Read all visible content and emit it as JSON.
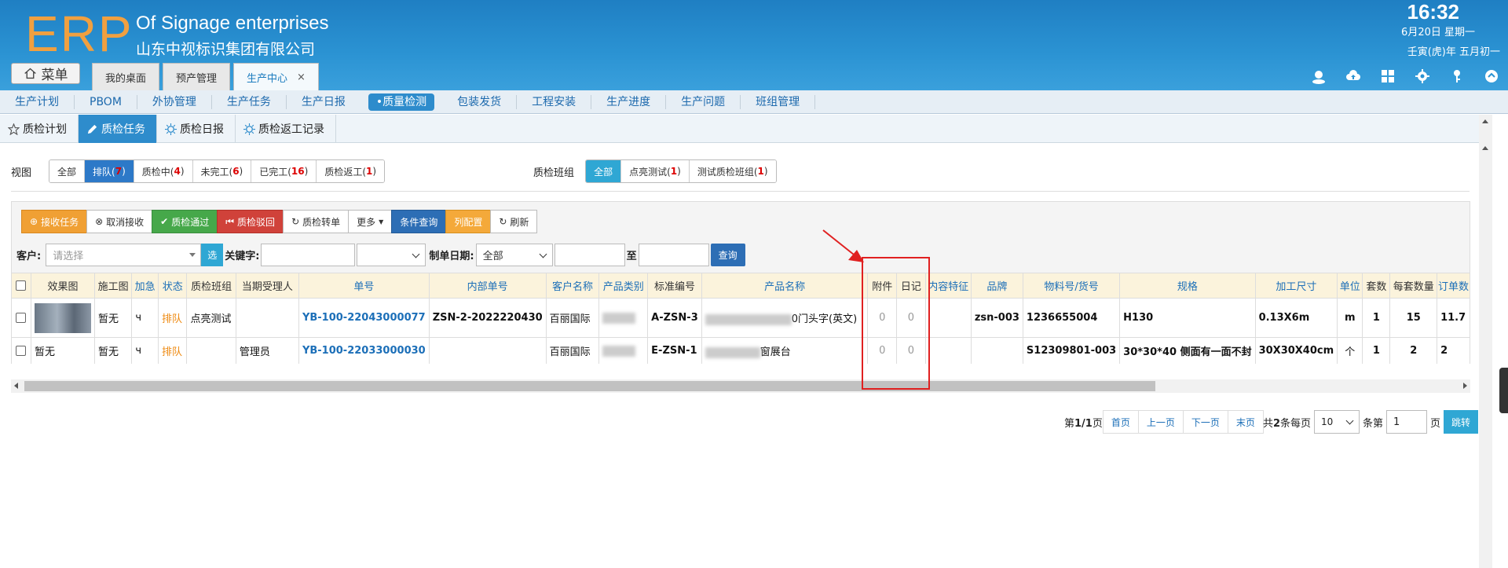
{
  "header": {
    "logo": "ERP",
    "subtitle_en": "Of Signage enterprises",
    "subtitle_cn": "山东中视标识集团有限公司",
    "time": "16:32",
    "date": "6月20日 星期一",
    "lunar": "壬寅(虎)年 五月初一",
    "menu_label": "菜单",
    "tabs": [
      {
        "label": "我的桌面"
      },
      {
        "label": "预产管理"
      },
      {
        "label": "生产中心",
        "close": "×"
      }
    ]
  },
  "nav": [
    "生产计划",
    "PBOM",
    "外协管理",
    "生产任务",
    "生产日报",
    "•质量检测",
    "包装发货",
    "工程安装",
    "生产进度",
    "生产问题",
    "班组管理"
  ],
  "subtabs": [
    "质检计划",
    "质检任务",
    "质检日报",
    "质检返工记录"
  ],
  "view": {
    "label": "视图",
    "all": "全部",
    "queue": "排队(",
    "queue_count": "7",
    "queue_close": ")",
    "inspecting": "质检中(",
    "inspecting_count": "4",
    "unfinished": "未完工(",
    "unfinished_count": "6",
    "finished": "已完工(",
    "finished_count": "16",
    "rework": "质检返工(",
    "rework_count": "1",
    "close": ")"
  },
  "group": {
    "label": "质检班组",
    "all": "全部",
    "g1": "点亮测试(",
    "g1_count": "1",
    "g2": "测试质检班组(",
    "g2_count": "1",
    "close": ")"
  },
  "toolbar": {
    "receive": "接收任务",
    "cancel_receive": "取消接收",
    "pass": "质检通过",
    "reject": "质检驳回",
    "transfer": "质检转单",
    "more": "更多",
    "condition_query": "条件查询",
    "columns": "列配置",
    "refresh": "刷新"
  },
  "filter": {
    "customer_label": "客户:",
    "customer_placeholder": "请选择",
    "select_btn": "选",
    "keyword_label": "关键字:",
    "date_label": "制单日期:",
    "date_option": "全部",
    "to": "至",
    "query": "查询"
  },
  "table": {
    "headers": [
      "效果图",
      "施工图",
      "加急",
      "状态",
      "质检班组",
      "当期受理人",
      "单号",
      "内部单号",
      "客户名称",
      "产品类别",
      "标准编号",
      "产品名称",
      "附件",
      "日记",
      "内容特征",
      "品牌",
      "物料号/货号",
      "规格",
      "加工尺寸",
      "单位",
      "套数",
      "每套数量",
      "订单数"
    ],
    "rows": [
      {
        "construction": "暂无",
        "urgent": "ч",
        "status": "排队",
        "group": "点亮测试",
        "handler": "",
        "order_no": "YB-100-22043000077",
        "internal_no": "ZSN-2-2022220430",
        "customer": "百丽国际",
        "std_no": "A-ZSN-3",
        "product": "0门头字(英文)",
        "attach": "0",
        "diary": "0",
        "feature": "",
        "brand": "zsn-003",
        "material": "1236655004",
        "spec": "H130",
        "size": "0.13X6m",
        "unit": "m",
        "sets": "1",
        "per_set": "15",
        "order_qty": "11.7"
      },
      {
        "effect": "暂无",
        "construction": "暂无",
        "urgent": "ч",
        "status": "排队",
        "group": "",
        "handler": "管理员",
        "order_no": "YB-100-22033000030",
        "internal_no": "",
        "customer": "百丽国际",
        "std_no": "E-ZSN-1",
        "product": "窗展台",
        "attach": "0",
        "diary": "0",
        "feature": "",
        "brand": "",
        "material": "S12309801-003",
        "spec": "30*30*40 侧面有一面不封",
        "size": "30X30X40cm",
        "unit": "个",
        "sets": "1",
        "per_set": "2",
        "order_qty": "2"
      }
    ]
  },
  "pager": {
    "page_info_pre": "第",
    "page_info": "1/1",
    "page_info_post": "页",
    "first": "首页",
    "prev": "上一页",
    "next": "下一页",
    "last": "末页",
    "total_pre": "共",
    "total": "2",
    "total_post": "条每页",
    "per_page": "10",
    "per_page_post": "条第",
    "goto_page": "1",
    "goto_post": "页",
    "jump": "跳转"
  },
  "colors": {
    "header_blue": "#2b93d3",
    "accent": "#2d79c8",
    "annotation": "#e02020"
  }
}
